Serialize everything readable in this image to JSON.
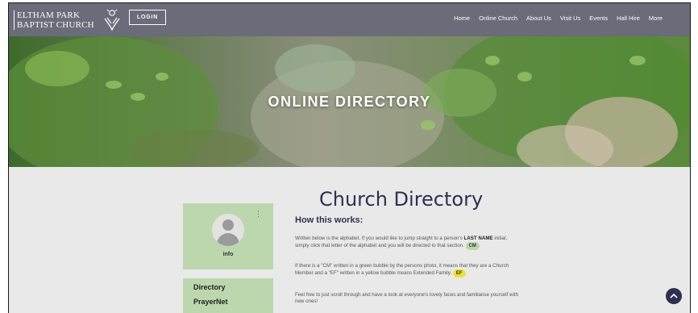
{
  "header": {
    "logo_line1": "ELTHAM PARK",
    "logo_line2": "BAPTIST CHURCH",
    "login_label": "LOGIN",
    "nav": [
      "Home",
      "Online Church",
      "About Us",
      "Visit Us",
      "Events",
      "Hall Hire",
      "More"
    ]
  },
  "hero": {
    "title": "ONLINE DIRECTORY"
  },
  "profile": {
    "label": "info"
  },
  "side_menu": [
    "Directory",
    "PrayerNet"
  ],
  "main": {
    "title": "Church Directory",
    "how_title": "How this works:",
    "para1_a": "Written below is the alphabet. If you would like to jump straight to a person's",
    "para1_bold": "LAST NAME",
    "para1_b": "initial, simply click that letter of the alphabet and you will be directed to that section.",
    "bubble_cm": "CM",
    "para2": "If there is a \"CM\" written in a green bubble by the persons photo, it means that they are a Church Member and a \"EF\" written in a yellow bubble means Extended Family.",
    "bubble_ef": "EF",
    "para3": "Feel free to just scroll through and have a look at everyone's lovely faces and familiarise yourself with new ones!"
  },
  "colors": {
    "header_bg": "#6b6b7a",
    "accent_green": "#bcd7ad",
    "accent_navy": "#2f2f52",
    "ef_yellow": "#f0e03a"
  },
  "icons": {
    "logo": "praying-hands-icon",
    "kebab": "more-vertical-icon",
    "scroll_top": "chevron-up-icon",
    "avatar": "user-silhouette-icon"
  }
}
